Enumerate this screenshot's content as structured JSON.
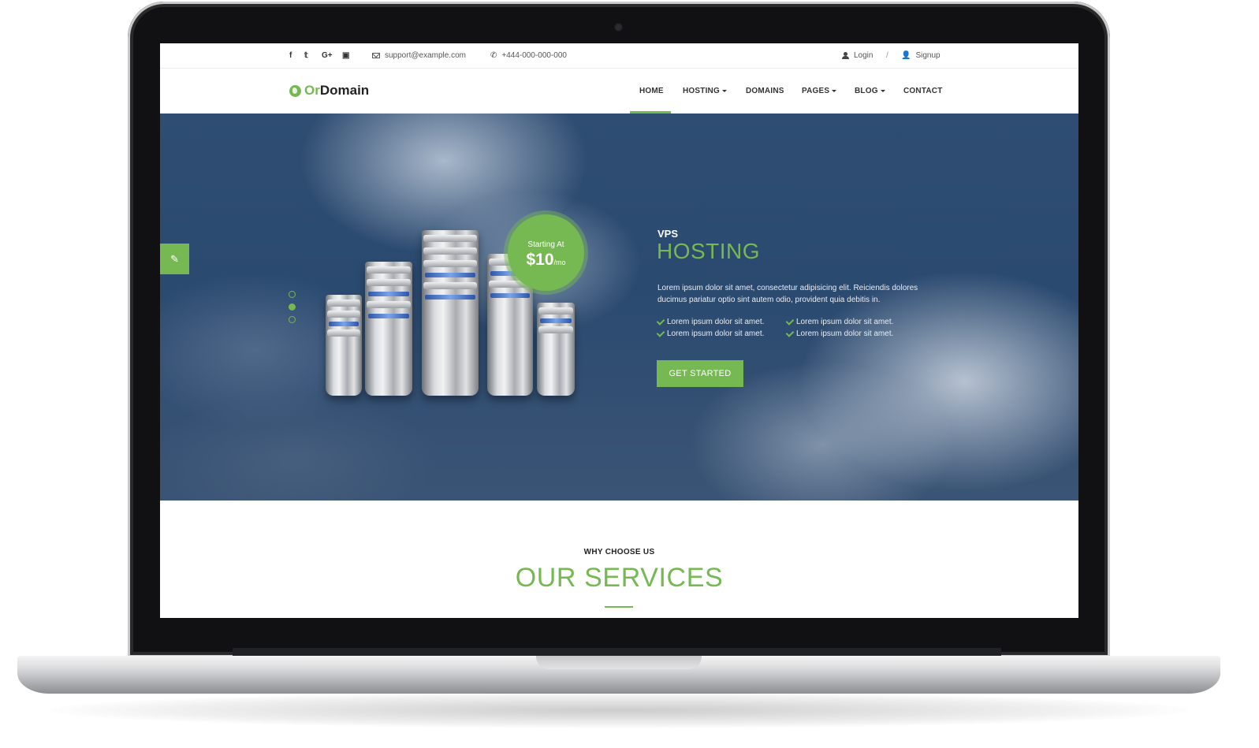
{
  "topbar": {
    "social": [
      {
        "icon": "facebook-icon",
        "glyph": "f"
      },
      {
        "icon": "twitter-icon",
        "glyph": "𝕥"
      },
      {
        "icon": "google-plus-icon",
        "glyph": "G+"
      },
      {
        "icon": "youtube-icon",
        "glyph": "▣"
      }
    ],
    "email": "support@example.com",
    "phone": "+444-000-000-000",
    "login": "Login",
    "separator": "/",
    "signup": "Signup"
  },
  "brand": {
    "logo_icon": "globe-icon",
    "part1": "Or",
    "part2": "Domain",
    "accent": "#76b852"
  },
  "nav": {
    "items": [
      {
        "label": "HOME",
        "active": true
      },
      {
        "label": "HOSTING",
        "dropdown": true
      },
      {
        "label": "DOMAINS"
      },
      {
        "label": "PAGES",
        "dropdown": true
      },
      {
        "label": "BLOG",
        "dropdown": true
      },
      {
        "label": "CONTACT"
      }
    ]
  },
  "hero": {
    "side_tab_icon": "brush-icon",
    "slides": 3,
    "active_slide": 2,
    "price": {
      "label": "Starting At",
      "value": "$10",
      "per": "/mo"
    },
    "kicker": "VPS",
    "title": "HOSTING",
    "description": "Lorem ipsum dolor sit amet, consectetur adipisicing elit. Reiciendis dolores ducimus pariatur optio sint autem odio, provident quia debitis in.",
    "features": [
      "Lorem ipsum dolor sit amet.",
      "Lorem ipsum dolor sit amet.",
      "Lorem ipsum dolor sit amet.",
      "Lorem ipsum dolor sit amet."
    ],
    "cta": "GET STARTED"
  },
  "services": {
    "kicker": "WHY CHOOSE US",
    "title": "OUR SERVICES"
  }
}
